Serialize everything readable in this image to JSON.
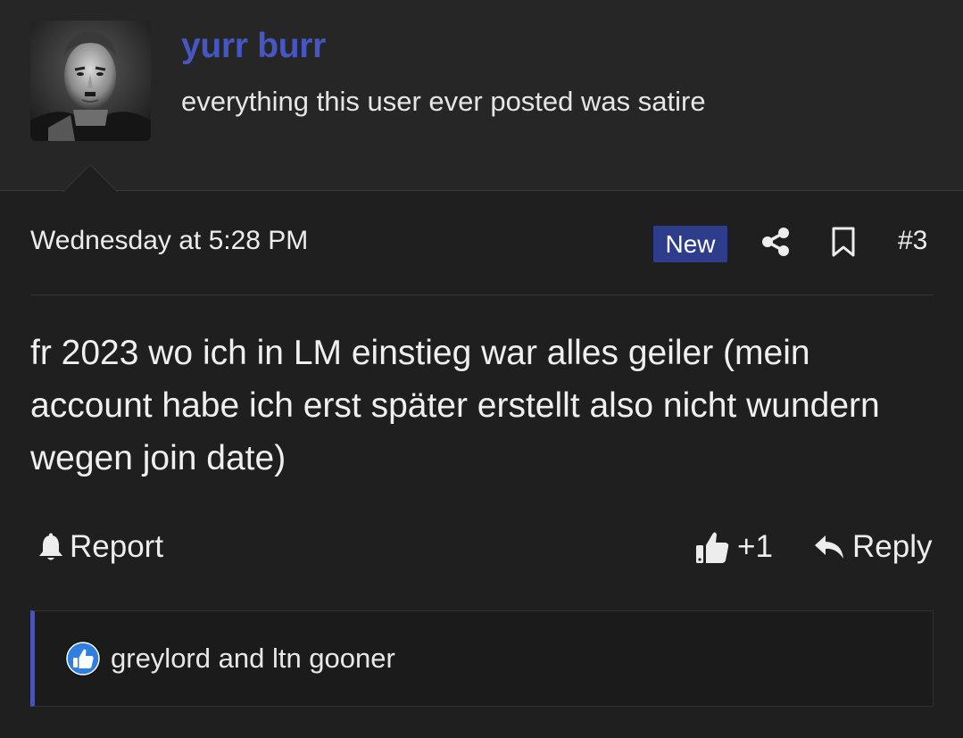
{
  "user": {
    "name": "yurr burr",
    "title": "everything this user ever posted was satire",
    "avatar_icon": "avatar-portrait",
    "name_color": "#4656c4"
  },
  "post": {
    "date": "Wednesday at 5:28 PM",
    "badge": "New",
    "badge_color": "#2d3d8c",
    "number": "#3",
    "body": "fr 2023 wo ich in LM einstieg war alles geiler (mein account habe ich erst später erstellt also nicht wundern wegen join date)"
  },
  "actions": {
    "report_label": "Report",
    "like_count": "+1",
    "reply_label": "Reply"
  },
  "reactions": {
    "users": "greylord and ltn gooner",
    "icon": "like-reaction-icon",
    "accent_color": "#4a55b0"
  }
}
